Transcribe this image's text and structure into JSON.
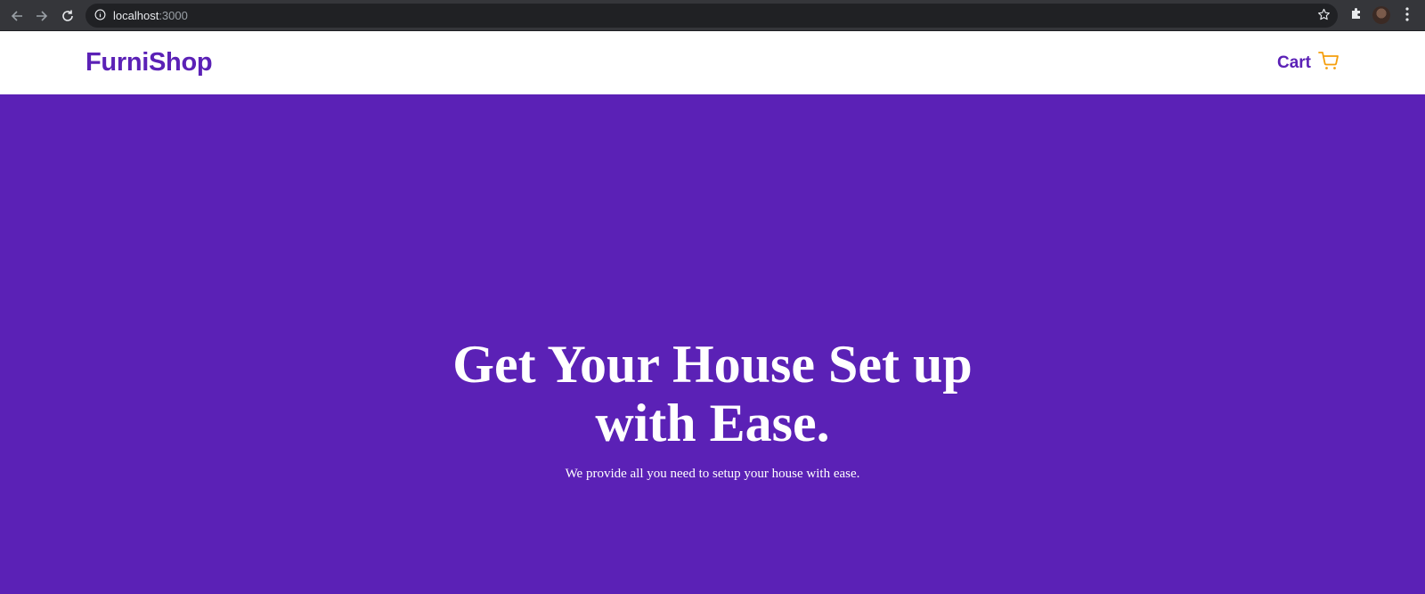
{
  "browser": {
    "url_host": "localhost",
    "url_port": ":3000",
    "icons": {
      "back": "back-arrow-icon",
      "forward": "forward-arrow-icon",
      "reload": "reload-icon",
      "site_info": "info-icon",
      "bookmark": "star-icon",
      "extensions": "puzzle-icon",
      "profile": "avatar",
      "menu": "kebab-menu-icon"
    }
  },
  "header": {
    "logo": "FurniShop",
    "cart_label": "Cart",
    "cart_icon": "cart-icon"
  },
  "hero": {
    "title_line1": "Get Your House Set up",
    "title_line2": "with Ease.",
    "subtitle": "We provide all you need to setup your house with ease."
  },
  "colors": {
    "brand": "#5b21b6",
    "cart_icon": "#f59e0b",
    "hero_text": "#ffffff"
  }
}
